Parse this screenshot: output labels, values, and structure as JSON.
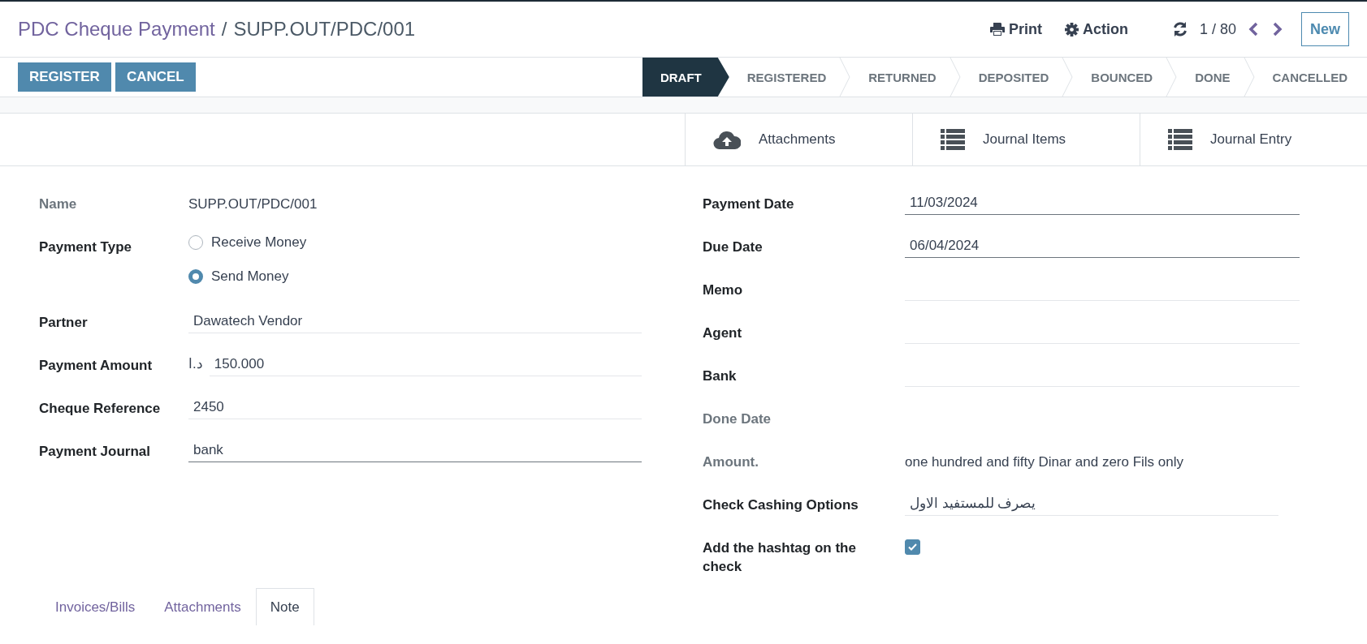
{
  "breadcrumb": {
    "parent": "PDC Cheque Payment",
    "separator": "/",
    "current": "SUPP.OUT/PDC/001"
  },
  "toolbar": {
    "print": "Print",
    "action": "Action",
    "pager": "1 / 80",
    "new_button": "New"
  },
  "action_buttons": [
    "REGISTER",
    "CANCEL"
  ],
  "statusbar": [
    {
      "label": "DRAFT",
      "selected": true
    },
    {
      "label": "REGISTERED",
      "selected": false
    },
    {
      "label": "RETURNED",
      "selected": false
    },
    {
      "label": "DEPOSITED",
      "selected": false
    },
    {
      "label": "BOUNCED",
      "selected": false
    },
    {
      "label": "DONE",
      "selected": false
    },
    {
      "label": "CANCELLED",
      "selected": false
    }
  ],
  "smart_buttons": [
    {
      "label": "Attachments",
      "kind": "upload"
    },
    {
      "label": "Journal Items",
      "kind": "list"
    },
    {
      "label": "Journal Entry",
      "kind": "list"
    }
  ],
  "left_fields": [
    {
      "label": "Name",
      "kind": "text",
      "readonly": true,
      "value": "SUPP.OUT/PDC/001"
    },
    {
      "label": "Payment Type",
      "kind": "radio",
      "readonly": false,
      "options": [
        {
          "label": "Receive Money",
          "selected": false
        },
        {
          "label": "Send Money",
          "selected": true
        }
      ]
    },
    {
      "label": "Partner",
      "kind": "input",
      "readonly": false,
      "required": false,
      "value": "Dawatech Vendor"
    },
    {
      "label": "Payment Amount",
      "kind": "monetary",
      "readonly": false,
      "required": false,
      "currency": "د.ا",
      "value": "150.000"
    },
    {
      "label": "Cheque Reference",
      "kind": "input",
      "readonly": false,
      "required": false,
      "value": "2450"
    },
    {
      "label": "Payment Journal",
      "kind": "input",
      "readonly": false,
      "required": true,
      "value": "bank"
    }
  ],
  "right_fields": [
    {
      "label": "Payment Date",
      "kind": "input",
      "readonly": false,
      "required": true,
      "value": "11/03/2024"
    },
    {
      "label": "Due Date",
      "kind": "input",
      "readonly": false,
      "required": true,
      "value": "06/04/2024"
    },
    {
      "label": "Memo",
      "kind": "input",
      "readonly": false,
      "required": false
    },
    {
      "label": "Agent",
      "kind": "input",
      "readonly": false,
      "required": false
    },
    {
      "label": "Bank",
      "kind": "input",
      "readonly": false,
      "required": false
    },
    {
      "label": "Done Date",
      "kind": "text",
      "readonly": true
    },
    {
      "label": "Amount.",
      "kind": "text",
      "readonly": true,
      "value": "one hundred and fifty Dinar and zero Fils only"
    },
    {
      "label": "Check Cashing Options",
      "kind": "input",
      "readonly": false,
      "required": false,
      "value": "يصرف للمستفيد الاول"
    },
    {
      "label": "Add the hashtag on the check",
      "kind": "checkbox",
      "readonly": false,
      "checked": true
    }
  ],
  "notebook_tabs": [
    {
      "label": "Invoices/Bills",
      "selected": false
    },
    {
      "label": "Attachments",
      "selected": false
    },
    {
      "label": "Note",
      "selected": true
    }
  ]
}
